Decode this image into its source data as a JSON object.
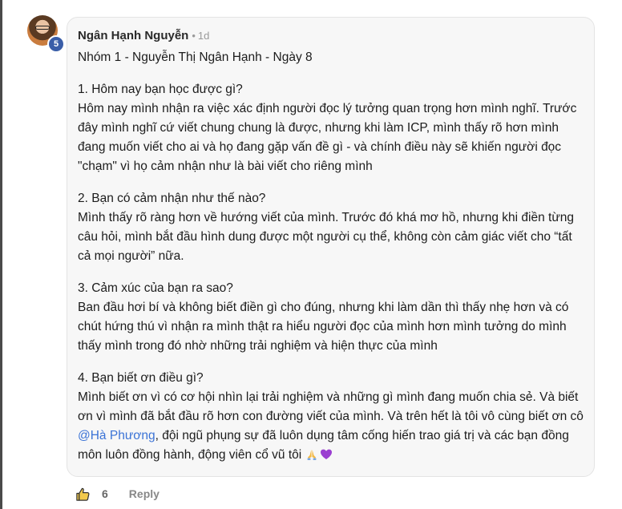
{
  "comment": {
    "author": "Ngân Hạnh Nguyễn",
    "separator": "•",
    "time": "1d",
    "level": "5",
    "title": "Nhóm 1 - Nguyễn Thị Ngân Hạnh - Ngày 8",
    "sections": [
      {
        "question": "1. Hôm nay bạn học được gì?",
        "answer": "Hôm nay mình nhận ra việc xác định người đọc lý tưởng quan trọng hơn mình nghĩ. Trước đây mình nghĩ cứ viết chung chung là được, nhưng khi làm ICP, mình thấy rõ hơn mình đang muốn viết cho ai và họ đang gặp vấn đề gì - và chính điều này sẽ khiến người đọc \"chạm\" vì họ cảm nhận như là bài viết cho riêng mình"
      },
      {
        "question": "2. Bạn có cảm nhận như thế nào?",
        "answer": "Mình thấy rõ ràng hơn về hướng viết của mình. Trước đó khá mơ hồ, nhưng khi điền từng câu hỏi, mình bắt đầu hình dung được một người cụ thể, không còn cảm giác viết cho “tất cả mọi người” nữa."
      },
      {
        "question": "3. Cảm xúc của bạn ra sao?",
        "answer": "Ban đầu hơi bí và không biết điền gì cho đúng, nhưng khi làm dần thì thấy nhẹ hơn và có chút hứng thú vì nhận ra mình thật ra hiểu người đọc của mình hơn mình tưởng do mình thấy mình trong đó nhờ những trải nghiệm và hiện thực của mình"
      },
      {
        "question": "4. Bạn biết ơn điều gì?",
        "answer_before_mention": "Mình biết ơn vì có cơ hội nhìn lại trải nghiệm và những gì mình đang muốn chia sẻ. Và biết ơn vì mình đã bắt đầu rõ hơn con đường viết của mình. Và trên hết là tôi vô cùng biết ơn cô ",
        "mention": "@Hà Phương",
        "answer_after_mention": ", đội ngũ phụng sự đã luôn dụng tâm cống hiến trao giá trị và các bạn đồng môn luôn đồng hành, động viên cổ vũ tôi "
      }
    ],
    "emojis": [
      "folded-hands-emoji",
      "purple-heart-emoji"
    ]
  },
  "actions": {
    "like_icon": "thumbs-up-icon",
    "like_count": "6",
    "reply_label": "Reply"
  },
  "colors": {
    "bubble_bg": "#f7f7f7",
    "mention": "#3b73d6",
    "badge": "#3a5ea8"
  }
}
